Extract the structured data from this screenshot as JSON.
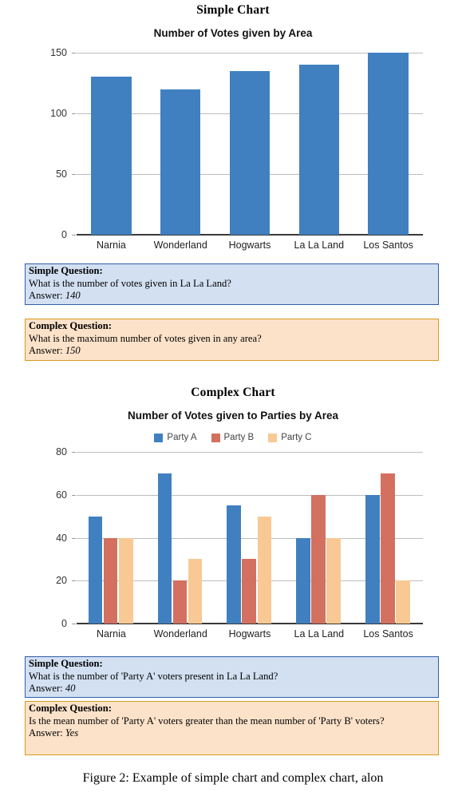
{
  "figure": {
    "caption": "Figure 2: Example of simple chart and complex chart, alon"
  },
  "simple_section": {
    "heading": "Simple Chart",
    "simple_question": {
      "label": "Simple Question:",
      "question": "What is the number of votes given in La La Land?",
      "answer_prefix": "Answer: ",
      "answer": "140"
    },
    "complex_question": {
      "label": "Complex Question:",
      "question": "What is the maximum number of votes given in any area?",
      "answer_prefix": "Answer: ",
      "answer": "150"
    }
  },
  "complex_section": {
    "heading": "Complex Chart",
    "simple_question": {
      "label": "Simple Question:",
      "question": "What is the number of 'Party A' voters present in La La Land?",
      "answer_prefix": "Answer: ",
      "answer": "40"
    },
    "complex_question": {
      "label": "Complex Question:",
      "question": "Is the mean number of 'Party A' voters greater than the mean number of 'Party B' voters?",
      "answer_prefix": "Answer: ",
      "answer": "Yes"
    }
  },
  "colors": {
    "party_a": "#4080c0",
    "party_b": "#d4705f",
    "party_c": "#f8c994",
    "grid": "#bdbdbd",
    "axis": "#3a3a3a",
    "simple_box_bg": "#d2e0f2",
    "simple_box_border": "#2f5fa8",
    "complex_box_bg": "#fce2c9",
    "complex_box_border": "#d79b1e"
  },
  "chart_data": [
    {
      "id": "simple-chart",
      "type": "bar",
      "title": "Number of Votes given by Area",
      "xlabel": "",
      "ylabel": "",
      "categories": [
        "Narnia",
        "Wonderland",
        "Hogwarts",
        "La La Land",
        "Los Santos"
      ],
      "values": [
        130,
        120,
        135,
        140,
        150
      ],
      "yticks": [
        0,
        50,
        100,
        150
      ],
      "ylim": [
        0,
        150
      ],
      "grid": true,
      "legend": false,
      "series_color": "#4080c0"
    },
    {
      "id": "complex-chart",
      "type": "bar",
      "title": "Number of Votes given to Parties by Area",
      "xlabel": "",
      "ylabel": "",
      "categories": [
        "Narnia",
        "Wonderland",
        "Hogwarts",
        "La La Land",
        "Los Santos"
      ],
      "series": [
        {
          "name": "Party A",
          "color": "#4080c0",
          "values": [
            50,
            70,
            55,
            40,
            60
          ]
        },
        {
          "name": "Party B",
          "color": "#d4705f",
          "values": [
            40,
            20,
            30,
            60,
            70
          ]
        },
        {
          "name": "Party C",
          "color": "#f8c994",
          "values": [
            40,
            30,
            50,
            40,
            20
          ]
        }
      ],
      "yticks": [
        0,
        20,
        40,
        60,
        80
      ],
      "ylim": [
        0,
        80
      ],
      "grid": true,
      "legend": true,
      "legend_position": "top-center"
    }
  ]
}
